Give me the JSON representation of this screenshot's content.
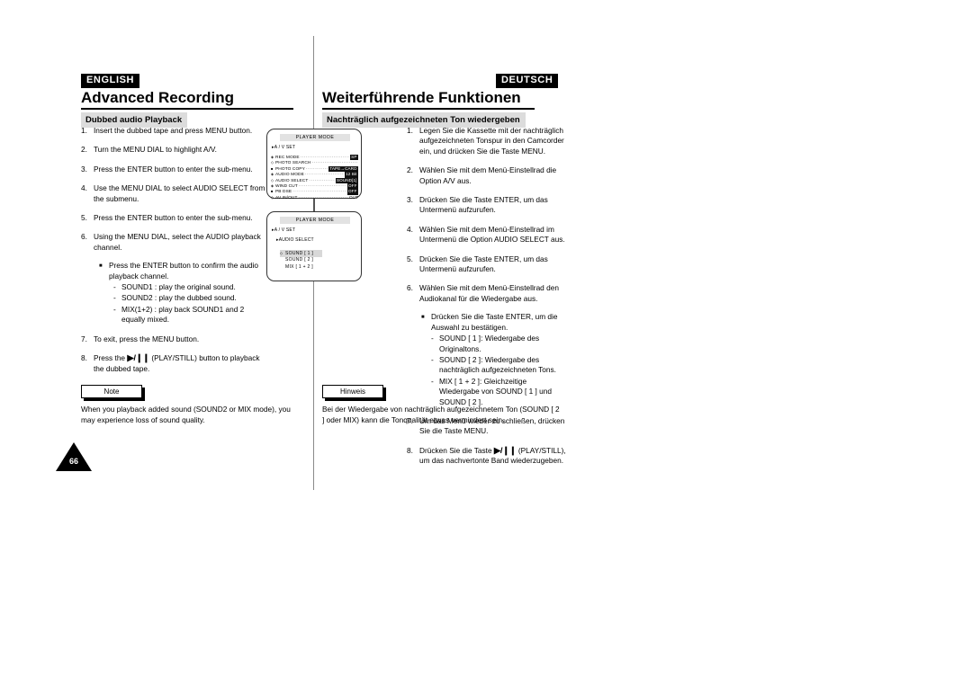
{
  "page": {
    "number": "66"
  },
  "left": {
    "language_badge": "ENGLISH",
    "chapter_title": "Advanced Recording",
    "section_title": "Dubbed audio Playback",
    "steps": [
      {
        "num": "1.",
        "text": "Insert the dubbed tape and press MENU button."
      },
      {
        "num": "2.",
        "text": "Turn the MENU DIAL to highlight A/V."
      },
      {
        "num": "3.",
        "text": "Press the ENTER button to enter the sub-menu."
      },
      {
        "num": "4.",
        "text": "Use the MENU DIAL to select AUDIO SELECT from the submenu."
      },
      {
        "num": "5.",
        "text": "Press the ENTER button to enter the sub-menu."
      },
      {
        "num": "6.",
        "text": "Using the MENU DIAL, select the AUDIO playback channel.",
        "bullet": "Press the ENTER button to confirm the audio playback channel.",
        "dashes": [
          "SOUND1 : play the original sound.",
          "SOUND2 : play the dubbed sound.",
          "MIX(1+2) : play back SOUND1 and 2 equally mixed."
        ]
      },
      {
        "num": "7.",
        "text": "To exit, press the MENU button."
      },
      {
        "num": "8.",
        "pre": "Press the",
        "icon": "▶/❙❙",
        "post": "(PLAY/STILL) button to playback the dubbed tape."
      }
    ],
    "note_label": "Note",
    "note_text": "When you playback added sound (SOUND2 or MIX mode), you may experience loss of sound quality."
  },
  "right": {
    "language_badge": "DEUTSCH",
    "chapter_title": "Weiterführende Funktionen",
    "section_title": "Nachträglich aufgezeichneten Ton wiedergeben",
    "steps": [
      {
        "num": "1.",
        "text": "Legen Sie die Kassette mit der nachträglich aufgezeichneten Tonspur in den Camcorder ein, und drücken Sie die Taste MENU."
      },
      {
        "num": "2.",
        "text": "Wählen Sie mit dem Menü-Einstellrad die Option A/V aus."
      },
      {
        "num": "3.",
        "text": "Drücken Sie die Taste ENTER, um das Untermenü aufzurufen."
      },
      {
        "num": "4.",
        "text": "Wählen Sie mit dem Menü-Einstellrad im Untermenü die Option AUDIO SELECT aus."
      },
      {
        "num": "5.",
        "text": "Drücken Sie die Taste ENTER, um das Untermenü aufzurufen."
      },
      {
        "num": "6.",
        "text": "Wählen Sie mit dem Menü-Einstellrad den Audiokanal für die Wiedergabe aus.",
        "bullet": "Drücken Sie die Taste ENTER, um die Auswahl zu bestätigen.",
        "dashes": [
          "SOUND [ 1 ]: Wiedergabe des Originaltons.",
          "SOUND [ 2 ]: Wiedergabe des nachträglich aufgezeichneten Tons.",
          "MIX [ 1 + 2 ]: Gleichzeitige Wiedergabe von SOUND  [ 1 ] und SOUND  [ 2 ]."
        ]
      },
      {
        "num": "7.",
        "text": "Um das Menü wieder zu schließen, drücken Sie die Taste MENU."
      },
      {
        "num": "8.",
        "pre": "Drücken Sie die Taste",
        "icon": "▶/❙❙",
        "post": "(PLAY/STILL), um das nachvertonte Band wiederzugeben."
      }
    ],
    "note_label": "Hinweis",
    "note_text": "Bei der Wiedergabe von nachträglich aufgezeichnetem Ton (SOUND [ 2 ] oder MIX) kann die Tonqualität etwas vermindert sein."
  },
  "lcd_screens": [
    {
      "title": "PLAYER MODE",
      "breadcrumb": "A / V SET",
      "rows": [
        {
          "marker": "◈",
          "label": "REC MODE",
          "value": "SP",
          "inverted": true
        },
        {
          "marker": "◇",
          "label": "PHOTO SEARCH",
          "value": "",
          "inverted": false
        },
        {
          "marker": "■",
          "label": "PHOTO COPY",
          "value": "TAPE→CARD",
          "inverted": true
        },
        {
          "marker": "◈",
          "label": "AUDIO MODE",
          "value": "12 Bit",
          "inverted": true
        },
        {
          "marker": "◇",
          "label": "AUDIO SELECT",
          "value": "SOUND[1]",
          "inverted": true
        },
        {
          "marker": "◈",
          "label": "WIND CUT",
          "value": "OFF",
          "inverted": true
        },
        {
          "marker": "■",
          "label": "PB DSE",
          "value": "OFF",
          "inverted": true
        },
        {
          "marker": "◇",
          "label": "AV IN/OUT",
          "value": "OUT",
          "inverted": false
        }
      ]
    },
    {
      "title": "PLAYER MODE",
      "breadcrumb": "A / V SET",
      "submenu": "AUDIO SELECT",
      "options": [
        {
          "label": "SOUND [ 1 ]",
          "selected": true
        },
        {
          "label": "SOUND [ 2 ]",
          "selected": false
        },
        {
          "label": "MIX [ 1 + 2 ]",
          "selected": false
        }
      ]
    }
  ]
}
